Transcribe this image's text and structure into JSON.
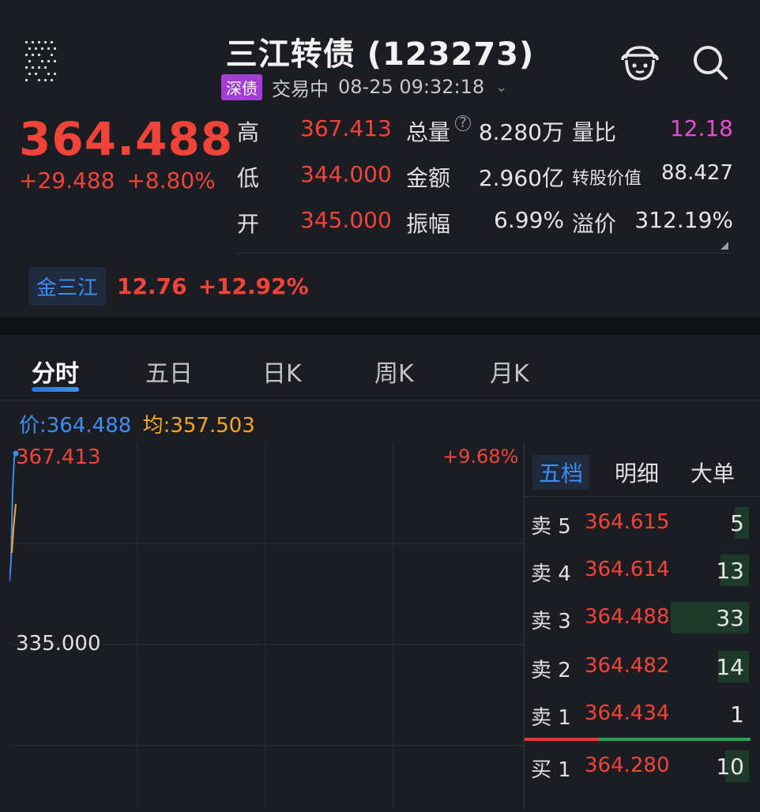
{
  "header": {
    "title": "三江转债 (123273)",
    "tag": "深债",
    "status": "交易中",
    "time": "08-25 09:32:18"
  },
  "quote": {
    "price": "364.488",
    "change": "+29.488",
    "change_pct": "+8.80%",
    "high_label": "高",
    "high": "367.413",
    "low_label": "低",
    "low": "344.000",
    "open_label": "开",
    "open": "345.000",
    "volume_label": "总量",
    "volume": "8.280万",
    "amount_label": "金额",
    "amount": "2.960亿",
    "amplitude_label": "振幅",
    "amplitude": "6.99%",
    "vol_ratio_label": "量比",
    "vol_ratio": "12.18",
    "conv_value_label": "转股价值",
    "conv_value": "88.427",
    "premium_label": "溢价",
    "premium": "312.19%"
  },
  "underlying": {
    "name": "金三江",
    "price": "12.76",
    "pct": "+12.92%"
  },
  "tabs": [
    "分时",
    "五日",
    "日K",
    "周K",
    "月K"
  ],
  "price_line": {
    "price_label": "价:",
    "price": "364.488",
    "avg_label": "均:",
    "avg": "357.503"
  },
  "chart_labels": {
    "high": "367.413",
    "pct": "+9.68%",
    "mid": "335.000"
  },
  "order_book": {
    "tabs": [
      "五档",
      "明细",
      "大单"
    ],
    "rows": [
      {
        "side": "卖 5",
        "price": "364.615",
        "vol": "5",
        "bar": 0.06
      },
      {
        "side": "卖 4",
        "price": "364.614",
        "vol": "13",
        "bar": 0.12
      },
      {
        "side": "卖 3",
        "price": "364.488",
        "vol": "33",
        "bar": 0.33
      },
      {
        "side": "卖 2",
        "price": "364.482",
        "vol": "14",
        "bar": 0.13
      },
      {
        "side": "卖 1",
        "price": "364.434",
        "vol": "1",
        "bar": 0.0
      },
      {
        "side": "买 1",
        "price": "364.280",
        "vol": "10",
        "bar": 0.1
      }
    ]
  },
  "colors": {
    "up": "#f0443a",
    "accent": "#3d8df2",
    "avg": "#f5a623",
    "tag": "#a43fd6",
    "ratio": "#e24fd1"
  }
}
